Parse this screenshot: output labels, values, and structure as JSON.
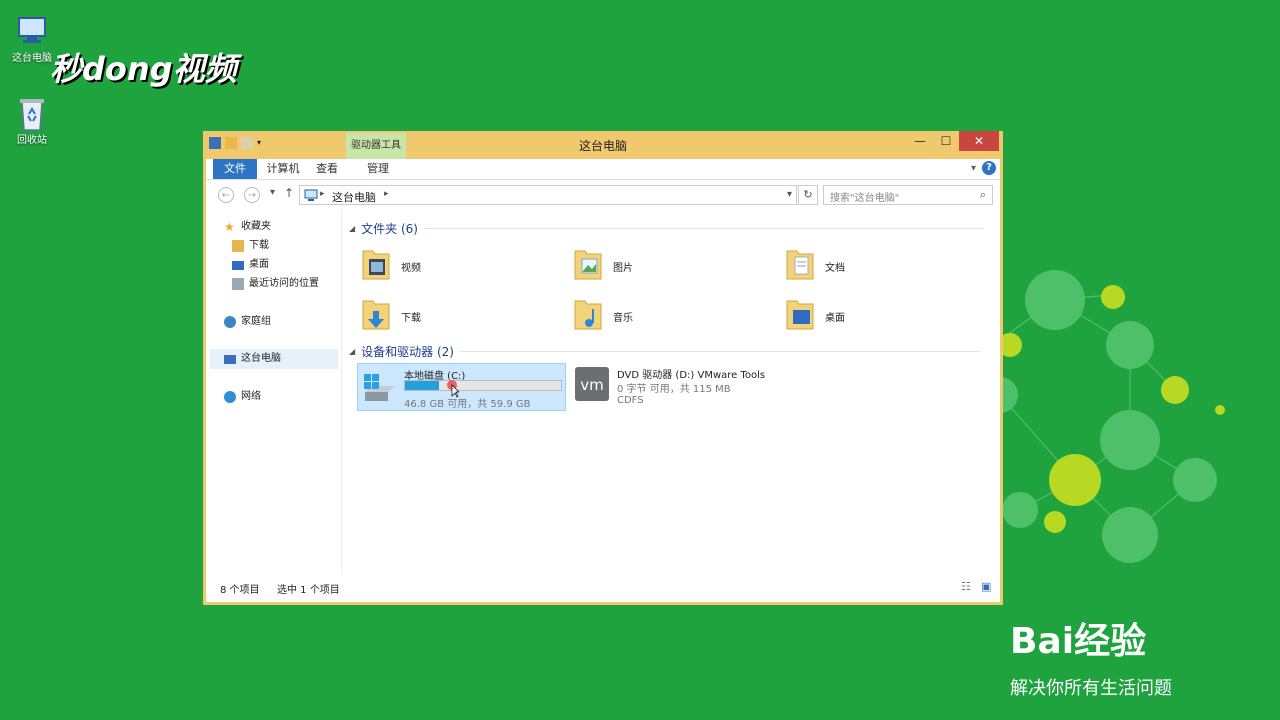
{
  "desktop": {
    "icons": [
      {
        "label": "这台电脑",
        "icon": "computer-icon"
      },
      {
        "label": "回收站",
        "icon": "recycle-bin-icon"
      }
    ],
    "watermark_tl": "秒dong视频",
    "watermark_br_brand": "Bai经验",
    "watermark_br_slogan": "解决你所有生活问题"
  },
  "window": {
    "title": "这台电脑",
    "context_tab": "驱动器工具",
    "ribbon_tabs": [
      "文件",
      "计算机",
      "查看",
      "管理"
    ],
    "address_crumb": "这台电脑",
    "search_placeholder": "搜索\"这台电脑\""
  },
  "nav": {
    "items": [
      "收藏夹",
      "下载",
      "桌面",
      "最近访问的位置",
      "家庭组",
      "这台电脑",
      "网络"
    ]
  },
  "folders_header": "文件夹 (6)",
  "folders": [
    "视频",
    "图片",
    "文档",
    "下载",
    "音乐",
    "桌面"
  ],
  "devices_header": "设备和驱动器 (2)",
  "drives": [
    {
      "name": "本地磁盘 (C:)",
      "free": "46.8 GB 可用，共 59.9 GB",
      "used_fraction": 0.22
    },
    {
      "name": "DVD 驱动器 (D:) VMware Tools",
      "free": "0 字节 可用，共 115 MB",
      "fs": "CDFS"
    }
  ],
  "status": {
    "count": "8 个项目",
    "selected": "选中 1 个项目"
  },
  "colors": {
    "desktop": "#1ea33f",
    "accent": "#2d74c4",
    "titlebar": "#f0c86e",
    "close": "#c7473f"
  }
}
